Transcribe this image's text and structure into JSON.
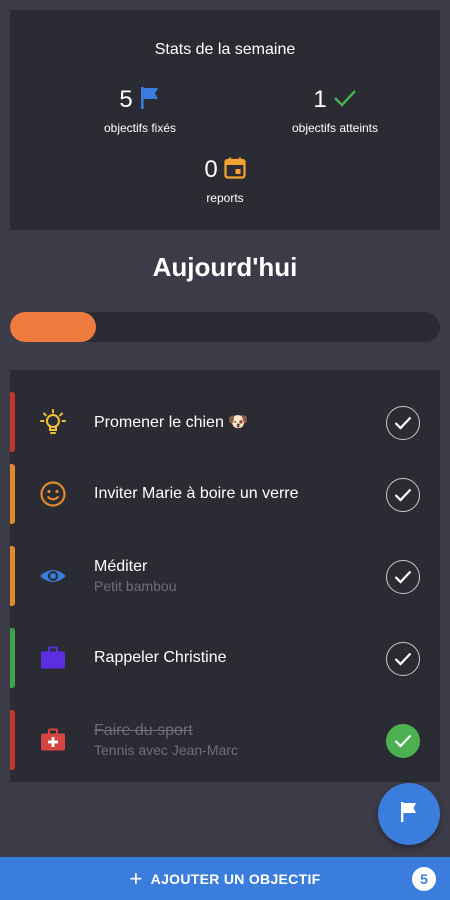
{
  "colors": {
    "background": "#3c3c48",
    "card": "#2b2b33",
    "accent_blue": "#3b7ddd",
    "progress_orange": "#f07b3f",
    "done_green": "#4caf50",
    "muted_text": "#6e6e78"
  },
  "stats": {
    "title": "Stats de la semaine",
    "fixed": {
      "count": "5",
      "label": "objectifs fixés",
      "icon": "flag-icon"
    },
    "reached": {
      "count": "1",
      "label": "objectifs atteints",
      "icon": "check-icon"
    },
    "reports": {
      "count": "0",
      "label": "reports",
      "icon": "calendar-icon"
    }
  },
  "today": {
    "title": "Aujourd'hui",
    "progress_fraction": 0.2
  },
  "tasks": [
    {
      "title": "Promener le chien 🐶",
      "subtitle": "",
      "icon": "lightbulb-icon",
      "bar_color": "#c0392b",
      "done": false
    },
    {
      "title": "Inviter Marie à boire un verre",
      "subtitle": "",
      "icon": "smiley-icon",
      "bar_color": "#e08a2c",
      "done": false
    },
    {
      "title": "Méditer",
      "subtitle": "Petit bambou",
      "icon": "eye-icon",
      "bar_color": "#e08a2c",
      "done": false
    },
    {
      "title": "Rappeler Christine",
      "subtitle": "",
      "icon": "briefcase-icon",
      "bar_color": "#3fa34d",
      "done": false
    },
    {
      "title": "Faire du sport",
      "subtitle": "Tennis avec Jean-Marc",
      "icon": "first-aid-kit-icon",
      "bar_color": "#c0392b",
      "done": true
    }
  ],
  "bottom_bar": {
    "add_label": "AJOUTER UN OBJECTIF",
    "badge": "5"
  }
}
